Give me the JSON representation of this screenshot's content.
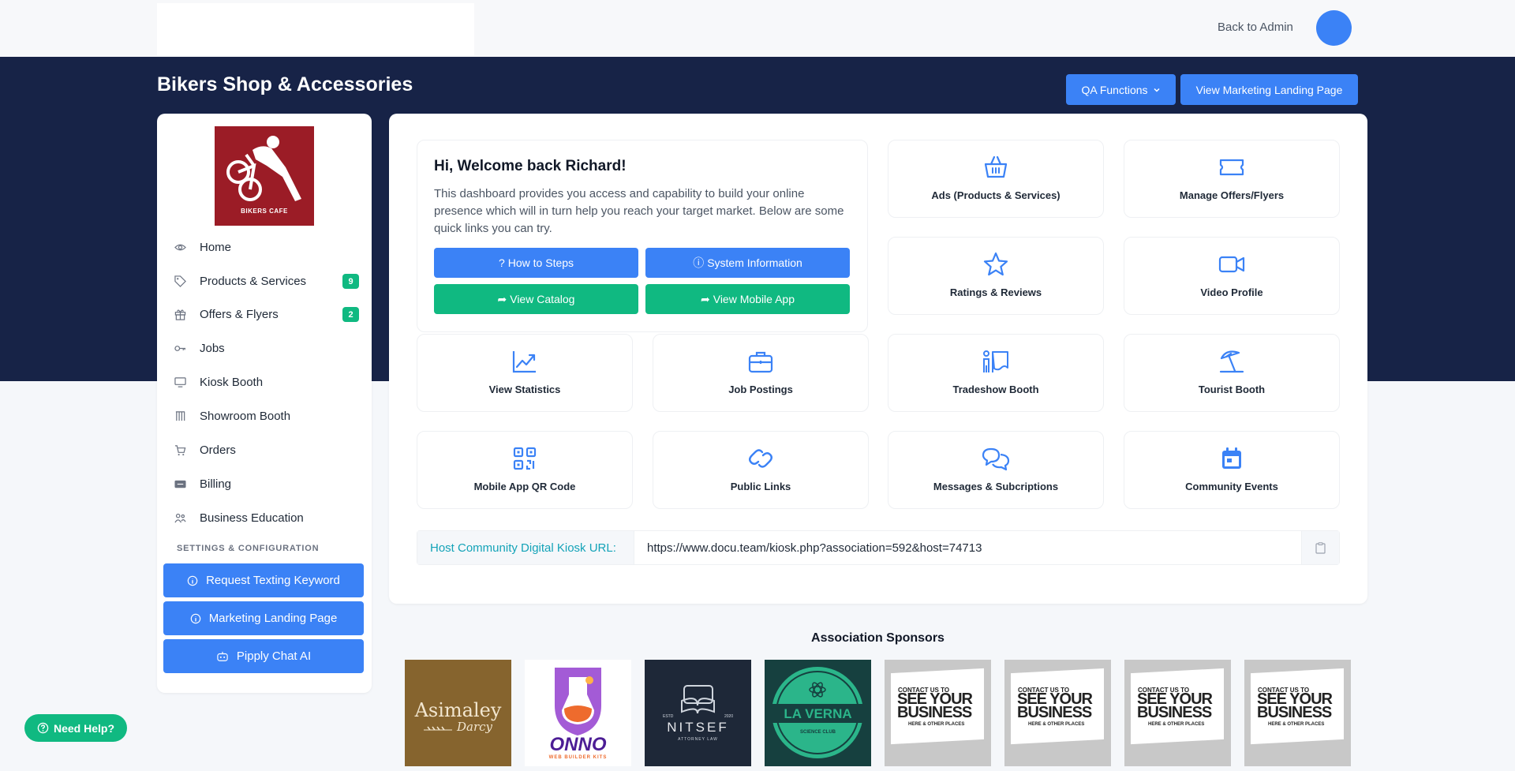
{
  "header": {
    "back_to_admin": "Back to Admin",
    "shop_title": "Bikers Shop & Accessories",
    "qa_functions": "QA Functions",
    "view_marketing": "View Marketing Landing Page"
  },
  "profile": {
    "logo_text": "BIKERS CAFE"
  },
  "sidebar": {
    "items": [
      {
        "label": "Home",
        "icon": "eye-icon"
      },
      {
        "label": "Products & Services",
        "icon": "tag-icon",
        "badge": "9"
      },
      {
        "label": "Offers & Flyers",
        "icon": "gift-icon",
        "badge": "2"
      },
      {
        "label": "Jobs",
        "icon": "key-icon"
      },
      {
        "label": "Kiosk Booth",
        "icon": "monitor-icon"
      },
      {
        "label": "Showroom Booth",
        "icon": "columns-icon"
      },
      {
        "label": "Orders",
        "icon": "cart-icon"
      },
      {
        "label": "Billing",
        "icon": "stripe-icon"
      },
      {
        "label": "Business Education",
        "icon": "users-icon"
      }
    ],
    "settings_heading": "SETTINGS & CONFIGURATION",
    "buttons": [
      {
        "label": "Request Texting Keyword",
        "icon": "info-icon"
      },
      {
        "label": "Marketing Landing Page",
        "icon": "info-icon"
      },
      {
        "label": "Pipply Chat AI",
        "icon": "robot-icon"
      }
    ]
  },
  "welcome": {
    "title": "Hi, Welcome back Richard!",
    "text": "This dashboard provides you access and capability to build your online presence which will in turn help you reach your target market. Below are some quick links you can try.",
    "buttons": [
      {
        "label": "How to Steps",
        "prefix": "?"
      },
      {
        "label": "System Information",
        "prefix": "ⓘ"
      },
      {
        "label": "View Catalog",
        "prefix": "➦"
      },
      {
        "label": "View Mobile App",
        "prefix": "➦"
      }
    ]
  },
  "tiles": [
    {
      "label": "Ads (Products & Services)",
      "icon": "basket-icon"
    },
    {
      "label": "Manage Offers/Flyers",
      "icon": "ticket-icon"
    },
    {
      "label": "Ratings & Reviews",
      "icon": "star-icon"
    },
    {
      "label": "Video Profile",
      "icon": "video-icon"
    },
    {
      "label": "View Statistics",
      "icon": "chart-line-icon"
    },
    {
      "label": "Job Postings",
      "icon": "briefcase-icon"
    },
    {
      "label": "Tradeshow Booth",
      "icon": "tradeshow-icon"
    },
    {
      "label": "Tourist Booth",
      "icon": "umbrella-beach-icon"
    },
    {
      "label": "Mobile App QR Code",
      "icon": "qr-code-icon"
    },
    {
      "label": "Public Links",
      "icon": "link-icon"
    },
    {
      "label": "Messages & Subcriptions",
      "icon": "chat-icon"
    },
    {
      "label": "Community Events",
      "icon": "calendar-icon"
    }
  ],
  "kiosk": {
    "label": "Host Community Digital Kiosk URL:",
    "url": "https://www.docu.team/kiosk.php?association=592&host=74713"
  },
  "sponsors": {
    "title": "Association Sponsors",
    "items": [
      {
        "name": "Asimaley",
        "sub": "Darcy"
      },
      {
        "name": "ONNO",
        "sub": "WEB BUILDER KITS"
      },
      {
        "name": "NITSEF",
        "sub": "ATTORNEY LAW",
        "estd": "ESTD",
        "year": "2020"
      },
      {
        "name": "LA VERNA",
        "sub": "SCIENCE CLUB"
      },
      {
        "top": "CONTACT US TO",
        "name": "SEE YOUR BUSINESS",
        "sub": "HERE & OTHER PLACES"
      },
      {
        "top": "CONTACT US TO",
        "name": "SEE YOUR BUSINESS",
        "sub": "HERE & OTHER PLACES"
      },
      {
        "top": "CONTACT US TO",
        "name": "SEE YOUR BUSINESS",
        "sub": "HERE & OTHER PLACES"
      },
      {
        "top": "CONTACT US TO",
        "name": "SEE YOUR BUSINESS",
        "sub": "HERE & OTHER PLACES"
      }
    ]
  },
  "help": {
    "label": "Need Help?"
  },
  "colors": {
    "navy": "#172347",
    "primary": "#3b82f6",
    "success": "#10b981",
    "teal": "#14a3b8"
  }
}
